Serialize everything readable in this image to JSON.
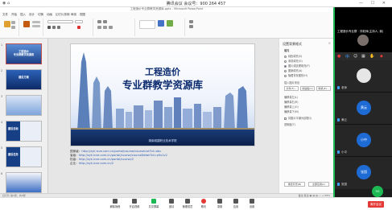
{
  "meeting": {
    "title": "腾讯会议 会议号：900 264 457",
    "left_icons": "◉ ⌂",
    "window_buttons": "— ☐ ✕"
  },
  "ppt": {
    "window_title": "工程造价专业群教学资源库.pptx - Microsoft PowerPoint",
    "tabs": [
      "文件",
      "开始",
      "插入",
      "设计",
      "切换",
      "动画",
      "幻灯片放映",
      "审阅",
      "视图"
    ],
    "thumbnails": [
      {
        "num": "1",
        "title": "工程造价\n专业群教学资源库"
      },
      {
        "num": "2",
        "title": "建设方案"
      },
      {
        "num": "3",
        "title": ""
      },
      {
        "num": "4",
        "title": "建设目标"
      },
      {
        "num": "5",
        "title": "建设任务"
      },
      {
        "num": "6",
        "title": ""
      }
    ],
    "slide": {
      "title_line1": "工程造价",
      "title_line2": "专业群教学资源库",
      "footer": "湖南城建职业技术学院"
    },
    "notes": [
      {
        "label": "国家级：",
        "value": "http://zyk.icve.com.cn/portal/course/courseList?id=abc"
      },
      {
        "label": "省级：",
        "value": "http://zyk.icve.com.cn/portal/course/courseDetail?id=p9x1v2"
      },
      {
        "label": "校级：",
        "value": "http://zyk.icve.com.cn/portal/course/2"
      },
      {
        "label": "企业：",
        "value": "http://zyk.icve.com.cn/2"
      }
    ],
    "design_pane": {
      "header": "设置背景格式",
      "close": "×",
      "options": [
        "填充",
        "纯色填充(S)",
        "渐变填充(G)",
        "图片或纹理填充(P)",
        "图案填充(A)",
        "隐藏背景图形(H)",
        "插入图片来自",
        "文件(F)...",
        "剪贴板(C)",
        "联机(E)...",
        "偏移量左(L)",
        "偏移量右(R)",
        "偏移量上(O)",
        "偏移量下(M)",
        "将图片平铺为纹理(I)",
        "透明度(T)",
        "重置背景(B)",
        "全部应用(L)"
      ]
    },
    "status": {
      "left": "幻灯片 第1张，共6张",
      "right": "备注  批注  ▣  ▤  ▥  —  +  59%"
    }
  },
  "toolbar": {
    "items": [
      {
        "label": "解除静音",
        "icon": "mic-icon"
      },
      {
        "label": "开启视频",
        "icon": "camera-icon"
      },
      {
        "label": "共享屏幕",
        "icon": "share-icon"
      },
      {
        "label": "邀请",
        "icon": "invite-icon"
      },
      {
        "label": "管理成员",
        "icon": "members-icon"
      },
      {
        "label": "聊天",
        "icon": "chat-icon"
      },
      {
        "label": "录制",
        "icon": "record-icon"
      },
      {
        "label": "应用",
        "icon": "apps-icon"
      },
      {
        "label": "设置",
        "icon": "gear-icon"
      }
    ],
    "end_label": "离开会议"
  },
  "participants": {
    "host_name": "工程造价专业群 · 刘老师(主持人, 我)",
    "tiles": [
      {
        "name": "老师",
        "avatar_text": "",
        "color": "#e6e6e6"
      },
      {
        "name": "黄云",
        "avatar_text": "黄云",
        "color": "#1e6bd6"
      },
      {
        "name": "小中",
        "avatar_text": "小中",
        "color": "#1e6bd6"
      },
      {
        "name": "张国",
        "avatar_text": "张国",
        "color": "#1e6bd6"
      }
    ],
    "network_badge": "5G"
  }
}
